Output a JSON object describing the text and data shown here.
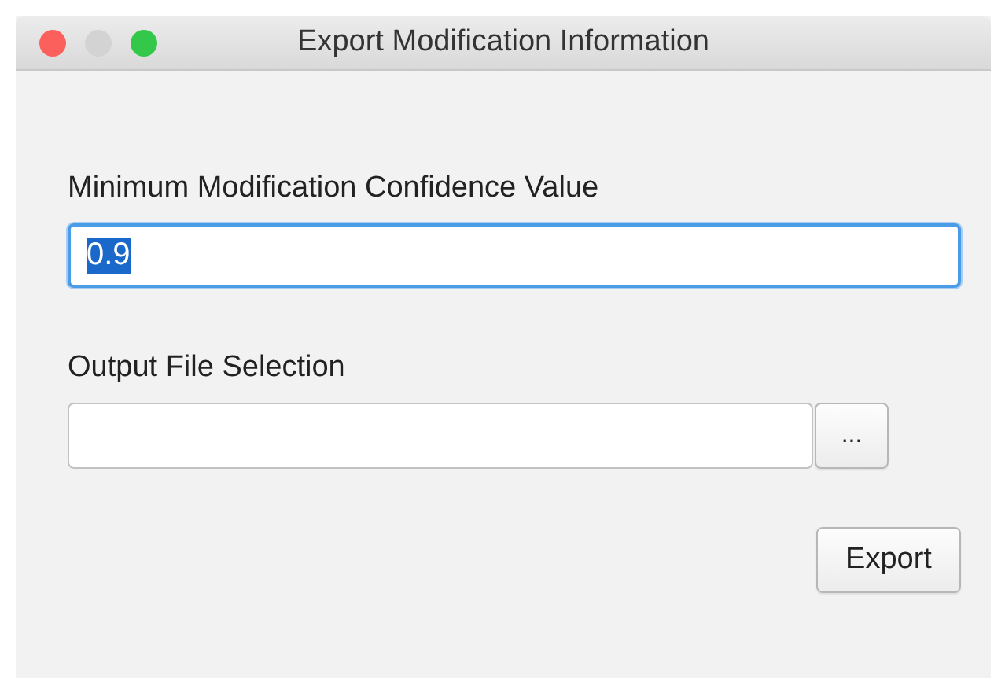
{
  "window": {
    "title": "Export Modification Information"
  },
  "confidence": {
    "label": "Minimum Modification Confidence Value",
    "value": "0.9",
    "focused": true,
    "value_selected": true
  },
  "output": {
    "label": "Output File Selection",
    "browse_button": "..."
  },
  "buttons": [
    "Export"
  ]
}
